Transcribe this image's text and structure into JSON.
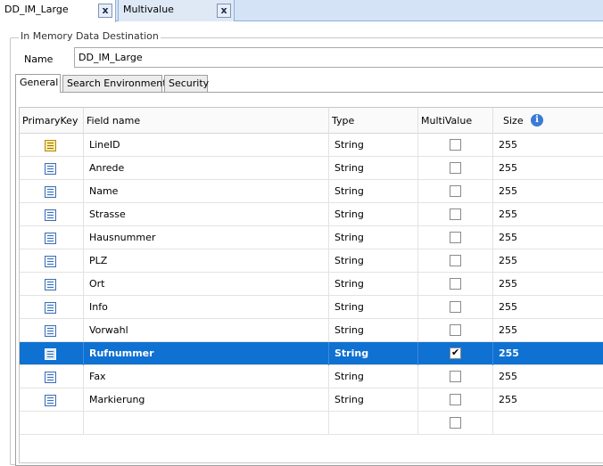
{
  "doc_tabs": [
    {
      "label": "DD_IM_Large",
      "close": "x"
    },
    {
      "label": "Multivalue",
      "close": "x"
    }
  ],
  "group": {
    "legend": "In Memory Data Destination"
  },
  "name_field": {
    "label": "Name",
    "value": "DD_IM_Large"
  },
  "inner_tabs": [
    {
      "label": "General"
    },
    {
      "label": "Search Environments"
    },
    {
      "label": "Security"
    }
  ],
  "grid": {
    "columns": {
      "primary_key": "PrimaryKey",
      "field_name": "Field name",
      "type": "Type",
      "multivalue": "MultiValue",
      "size": "Size"
    },
    "rows": [
      {
        "field": "LineID",
        "type": "String",
        "size": "255",
        "key": true,
        "multivalue": false,
        "selected": false
      },
      {
        "field": "Anrede",
        "type": "String",
        "size": "255",
        "key": false,
        "multivalue": false,
        "selected": false
      },
      {
        "field": "Name",
        "type": "String",
        "size": "255",
        "key": false,
        "multivalue": false,
        "selected": false
      },
      {
        "field": "Strasse",
        "type": "String",
        "size": "255",
        "key": false,
        "multivalue": false,
        "selected": false
      },
      {
        "field": "Hausnummer",
        "type": "String",
        "size": "255",
        "key": false,
        "multivalue": false,
        "selected": false
      },
      {
        "field": "PLZ",
        "type": "String",
        "size": "255",
        "key": false,
        "multivalue": false,
        "selected": false
      },
      {
        "field": "Ort",
        "type": "String",
        "size": "255",
        "key": false,
        "multivalue": false,
        "selected": false
      },
      {
        "field": "Info",
        "type": "String",
        "size": "255",
        "key": false,
        "multivalue": false,
        "selected": false
      },
      {
        "field": "Vorwahl",
        "type": "String",
        "size": "255",
        "key": false,
        "multivalue": false,
        "selected": false
      },
      {
        "field": "Rufnummer",
        "type": "String",
        "size": "255",
        "key": false,
        "multivalue": true,
        "selected": true
      },
      {
        "field": "Fax",
        "type": "String",
        "size": "255",
        "key": false,
        "multivalue": false,
        "selected": false
      },
      {
        "field": "Markierung",
        "type": "String",
        "size": "255",
        "key": false,
        "multivalue": false,
        "selected": false
      }
    ]
  },
  "icons": {
    "row_field": "field-list-icon",
    "row_key": "primary-key-field-icon",
    "size_info": "info-icon"
  },
  "colors": {
    "selection": "#0f71d1",
    "tabbar": "#d4e3f5"
  }
}
